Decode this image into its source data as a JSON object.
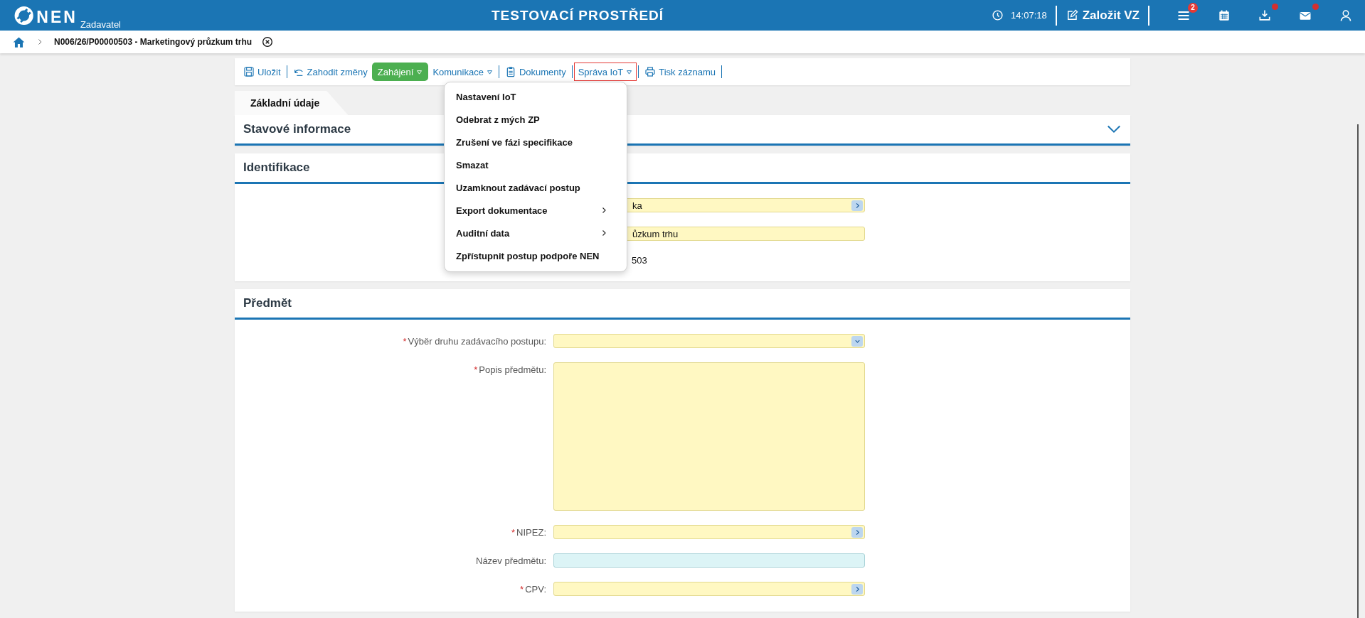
{
  "header": {
    "logo": "NEN",
    "role": "Zadavatel",
    "environment": "TESTOVACÍ PROSTŘEDÍ",
    "time": "14:07:18",
    "create_button": "Založit VZ",
    "icons": [
      {
        "kind": "tasks",
        "badge": "2",
        "dot": false
      },
      {
        "kind": "calendar",
        "dot": false
      },
      {
        "kind": "download",
        "dot": true
      },
      {
        "kind": "mail",
        "dot": true
      },
      {
        "kind": "user",
        "dot": false
      }
    ]
  },
  "breadcrumb": {
    "title": "N006/26/P00000503 - Marketingový průzkum trhu"
  },
  "toolbar": [
    {
      "kind": "save",
      "label": "Uložit",
      "selected": false
    },
    {
      "kind": "discard",
      "label": "Zahodit změny",
      "selected": false
    },
    {
      "kind": "primary-dropdown",
      "label": "Zahájení",
      "selected": false
    },
    {
      "kind": "dropdown",
      "label": "Komunikace",
      "selected": false
    },
    {
      "kind": "documents",
      "label": "Dokumenty",
      "selected": false
    },
    {
      "kind": "dropdown",
      "label": "Správa IoT",
      "selected": true
    },
    {
      "kind": "print",
      "label": "Tisk záznamu",
      "selected": false
    }
  ],
  "dropdown_menu": {
    "items": [
      {
        "label": "Nastavení IoT",
        "submenu": false
      },
      {
        "label": "Odebrat z mých ZP",
        "submenu": false
      },
      {
        "label": "Zrušení ve fázi specifikace",
        "submenu": false
      },
      {
        "label": "Smazat",
        "submenu": false
      },
      {
        "label": "Uzamknout zadávací postup",
        "submenu": false
      },
      {
        "label": "Export dokumentace",
        "submenu": true
      },
      {
        "label": "Auditní data",
        "submenu": true
      },
      {
        "label": "Zpřístupnit postup podpoře NEN",
        "submenu": false
      }
    ]
  },
  "tabs": [
    {
      "label": "Základní údaje",
      "selected": true
    }
  ],
  "panels": [
    {
      "title": "Stavové informace",
      "expanded": false
    },
    {
      "title": "Identifikace",
      "expanded": true,
      "fields": [
        {
          "kind": "lookup",
          "value": "ka"
        },
        {
          "kind": "text",
          "value": "ůzkum trhu"
        },
        {
          "kind": "plain",
          "value": "503"
        }
      ]
    },
    {
      "title": "Předmět",
      "expanded": true,
      "fields": [
        {
          "kind": "select",
          "marker": "*",
          "label": "Výběr druhu zadávacího postupu:"
        },
        {
          "kind": "textarea",
          "marker": "*",
          "label": "Popis předmětu:"
        },
        {
          "kind": "lookup",
          "marker": "*",
          "label": "NIPEZ:"
        },
        {
          "kind": "readonly",
          "label": "Název předmětu:"
        },
        {
          "kind": "lookup",
          "marker": "*",
          "label": "CPV:"
        }
      ]
    }
  ]
}
